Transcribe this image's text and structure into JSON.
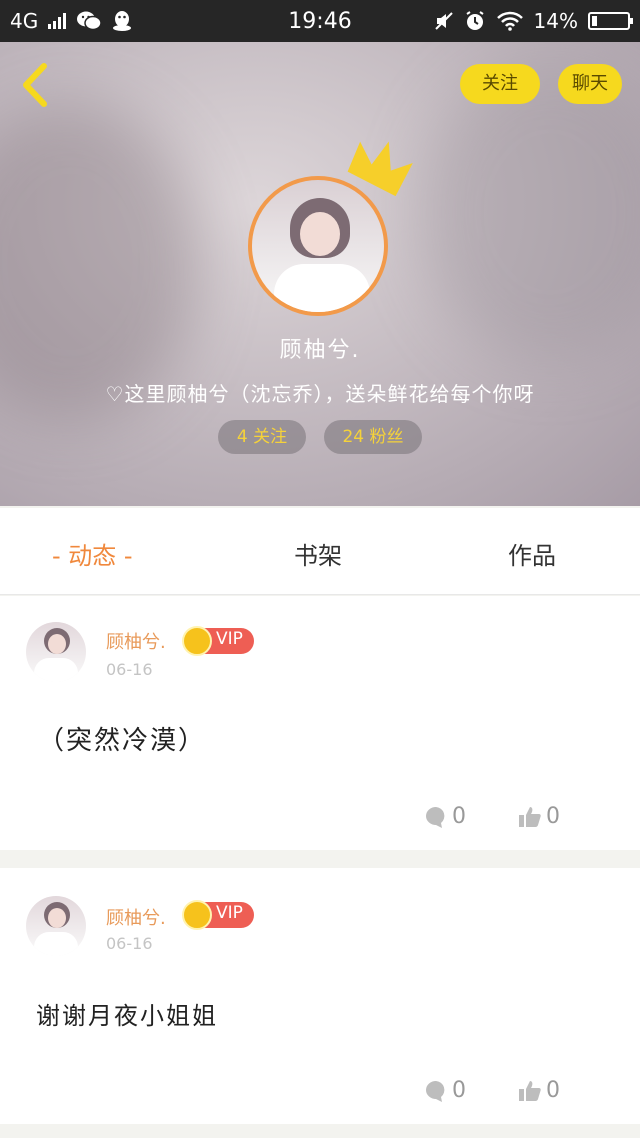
{
  "status_bar": {
    "network": "4G",
    "time": "19:46",
    "battery": "14%",
    "battery_level": 0.14,
    "icons": [
      "signal-icon",
      "wechat-icon",
      "qq-icon",
      "mute-icon",
      "alarm-icon",
      "wifi-icon",
      "battery-icon"
    ]
  },
  "header": {
    "follow_label": "关注",
    "chat_label": "聊天",
    "username": "顾柚兮.",
    "signature": "♡这里顾柚兮（沈忘乔），送朵鲜花给每个你呀",
    "following": "4 关注",
    "fans": "24 粉丝",
    "accent_color": "#f6d91e",
    "avatar_border_color": "#f29a4a"
  },
  "tabs": [
    {
      "label": "- 动态 -",
      "active": true
    },
    {
      "label": "书架",
      "active": false
    },
    {
      "label": "作品",
      "active": false
    }
  ],
  "posts": [
    {
      "author": "顾柚兮.",
      "badge": "VIP",
      "date": "06-16",
      "text": "（突然冷漠）",
      "comments": "0",
      "likes": "0"
    },
    {
      "author": "顾柚兮.",
      "badge": "VIP",
      "date": "06-16",
      "text": "谢谢月夜小姐姐",
      "comments": "0",
      "likes": "0"
    }
  ]
}
